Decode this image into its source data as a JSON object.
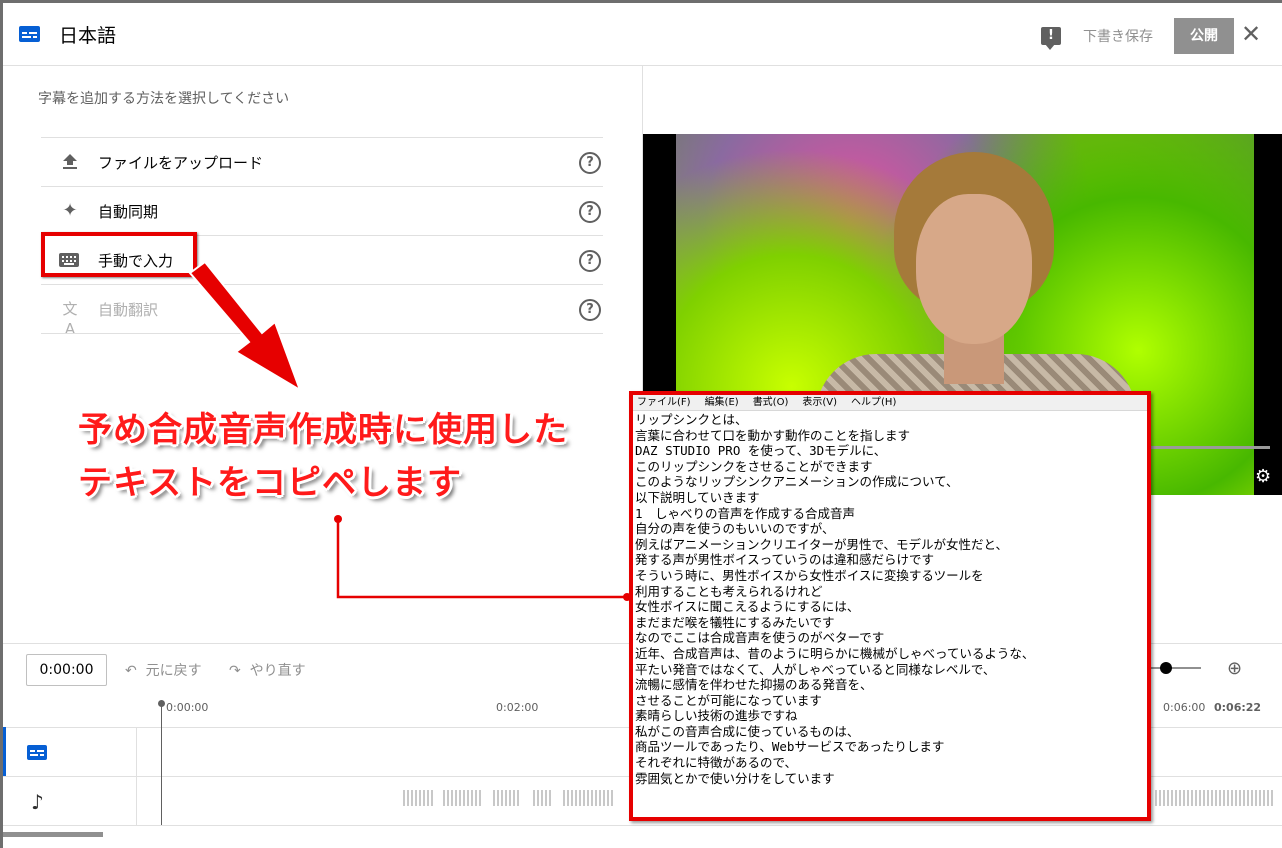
{
  "header": {
    "title": "日本語",
    "save_draft": "下書き保存",
    "publish": "公開",
    "close": "✕"
  },
  "panel": {
    "prompt": "字幕を追加する方法を選択してください",
    "options": [
      {
        "label": "ファイルをアップロード",
        "icon": "upload-icon",
        "help": "?"
      },
      {
        "label": "自動同期",
        "icon": "sparkle-icon",
        "help": "?"
      },
      {
        "label": "手動で入力",
        "icon": "keyboard-icon",
        "help": "?"
      },
      {
        "label": "自動翻訳",
        "icon": "translate-icon",
        "help": "?",
        "disabled": true
      }
    ]
  },
  "timeline": {
    "time": "0:00:00",
    "undo": "元に戻す",
    "redo": "やり直す",
    "ticks": [
      "0:00:00",
      "0:02:00",
      "0:06:00",
      "0:06:22"
    ]
  },
  "annotation": {
    "line1": "予め合成音声作成時に使用した",
    "line2": "テキストをコピペします",
    "color": "#e60000"
  },
  "notepad": {
    "menu": [
      "ファイル(F)",
      "編集(E)",
      "書式(O)",
      "表示(V)",
      "ヘルプ(H)"
    ],
    "lines": [
      "リップシンクとは、",
      "言葉に合わせて口を動かす動作のことを指します",
      "DAZ STUDIO PRO を使って、3Dモデルに、",
      "このリップシンクをさせることができます",
      "このようなリップシンクアニメーションの作成について、",
      "以下説明していきます",
      "1　しゃべりの音声を作成する合成音声",
      "自分の声を使うのもいいのですが、",
      "例えばアニメーションクリエイターが男性で、モデルが女性だと、",
      "発する声が男性ボイスっていうのは違和感だらけです",
      "そういう時に、男性ボイスから女性ボイスに変換するツールを",
      "利用することも考えられるけれど",
      "女性ボイスに聞こえるようにするには、",
      "まだまだ喉を犠牲にするみたいです",
      "なのでここは合成音声を使うのがベターです",
      "近年、合成音声は、昔のように明らかに機械がしゃべっているような、",
      "平たい発音ではなくて、人がしゃべっていると同様なレベルで、",
      "流暢に感情を伴わせた抑揚のある発音を、",
      "させることが可能になっています",
      "素晴らしい技術の進歩ですね",
      "私がこの音声合成に使っているものは、",
      "商品ツールであったり、Webサービスであったりします",
      "それぞれに特徴があるので、",
      "雰囲気とかで使い分けをしています"
    ]
  },
  "colors": {
    "accent": "#065fd4",
    "publish_bg": "#909090",
    "annotation": "#e60000"
  }
}
